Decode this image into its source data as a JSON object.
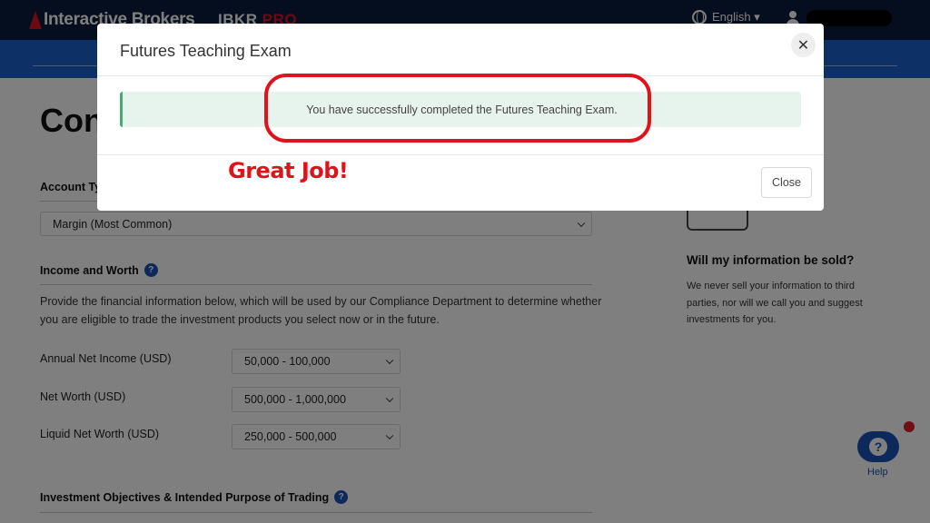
{
  "header": {
    "brand": "Interactive Brokers",
    "product_name": "IBKR",
    "product_suffix": "PRO",
    "language": "English ▾"
  },
  "page": {
    "title": "Configure Account",
    "account_type_label": "Account Type",
    "account_type_value": "Margin (Most Common)",
    "income_section_label": "Income and Worth",
    "income_description": "Provide the financial information below, which will be used by our Compliance Department to determine whether you are eligible to trade the investment products you select now or in the future.",
    "fields": [
      {
        "label": "Annual Net Income (USD)",
        "value": "50,000 - 100,000"
      },
      {
        "label": "Net Worth (USD)",
        "value": "500,000 - 1,000,000"
      },
      {
        "label": "Liquid Net Worth (USD)",
        "value": "250,000 - 500,000"
      }
    ],
    "objectives_label": "Investment Objectives & Intended Purpose of Trading",
    "help_glyph": "?"
  },
  "sidebar": {
    "title": "Will my information be sold?",
    "text": "We never sell your information to third parties, nor will we call you and suggest investments for you."
  },
  "help_widget": {
    "glyph": "?",
    "label": "Help"
  },
  "modal": {
    "title": "Futures Teaching Exam",
    "close_glyph": "✕",
    "message": "You have successfully completed the Futures Teaching Exam.",
    "close_label": "Close"
  },
  "annotation": {
    "text": "Great Job!"
  },
  "colors": {
    "accent_blue": "#1a63cf",
    "brand_red": "#d81222",
    "annotation_red": "#e0131c",
    "success_green": "#49a879"
  }
}
